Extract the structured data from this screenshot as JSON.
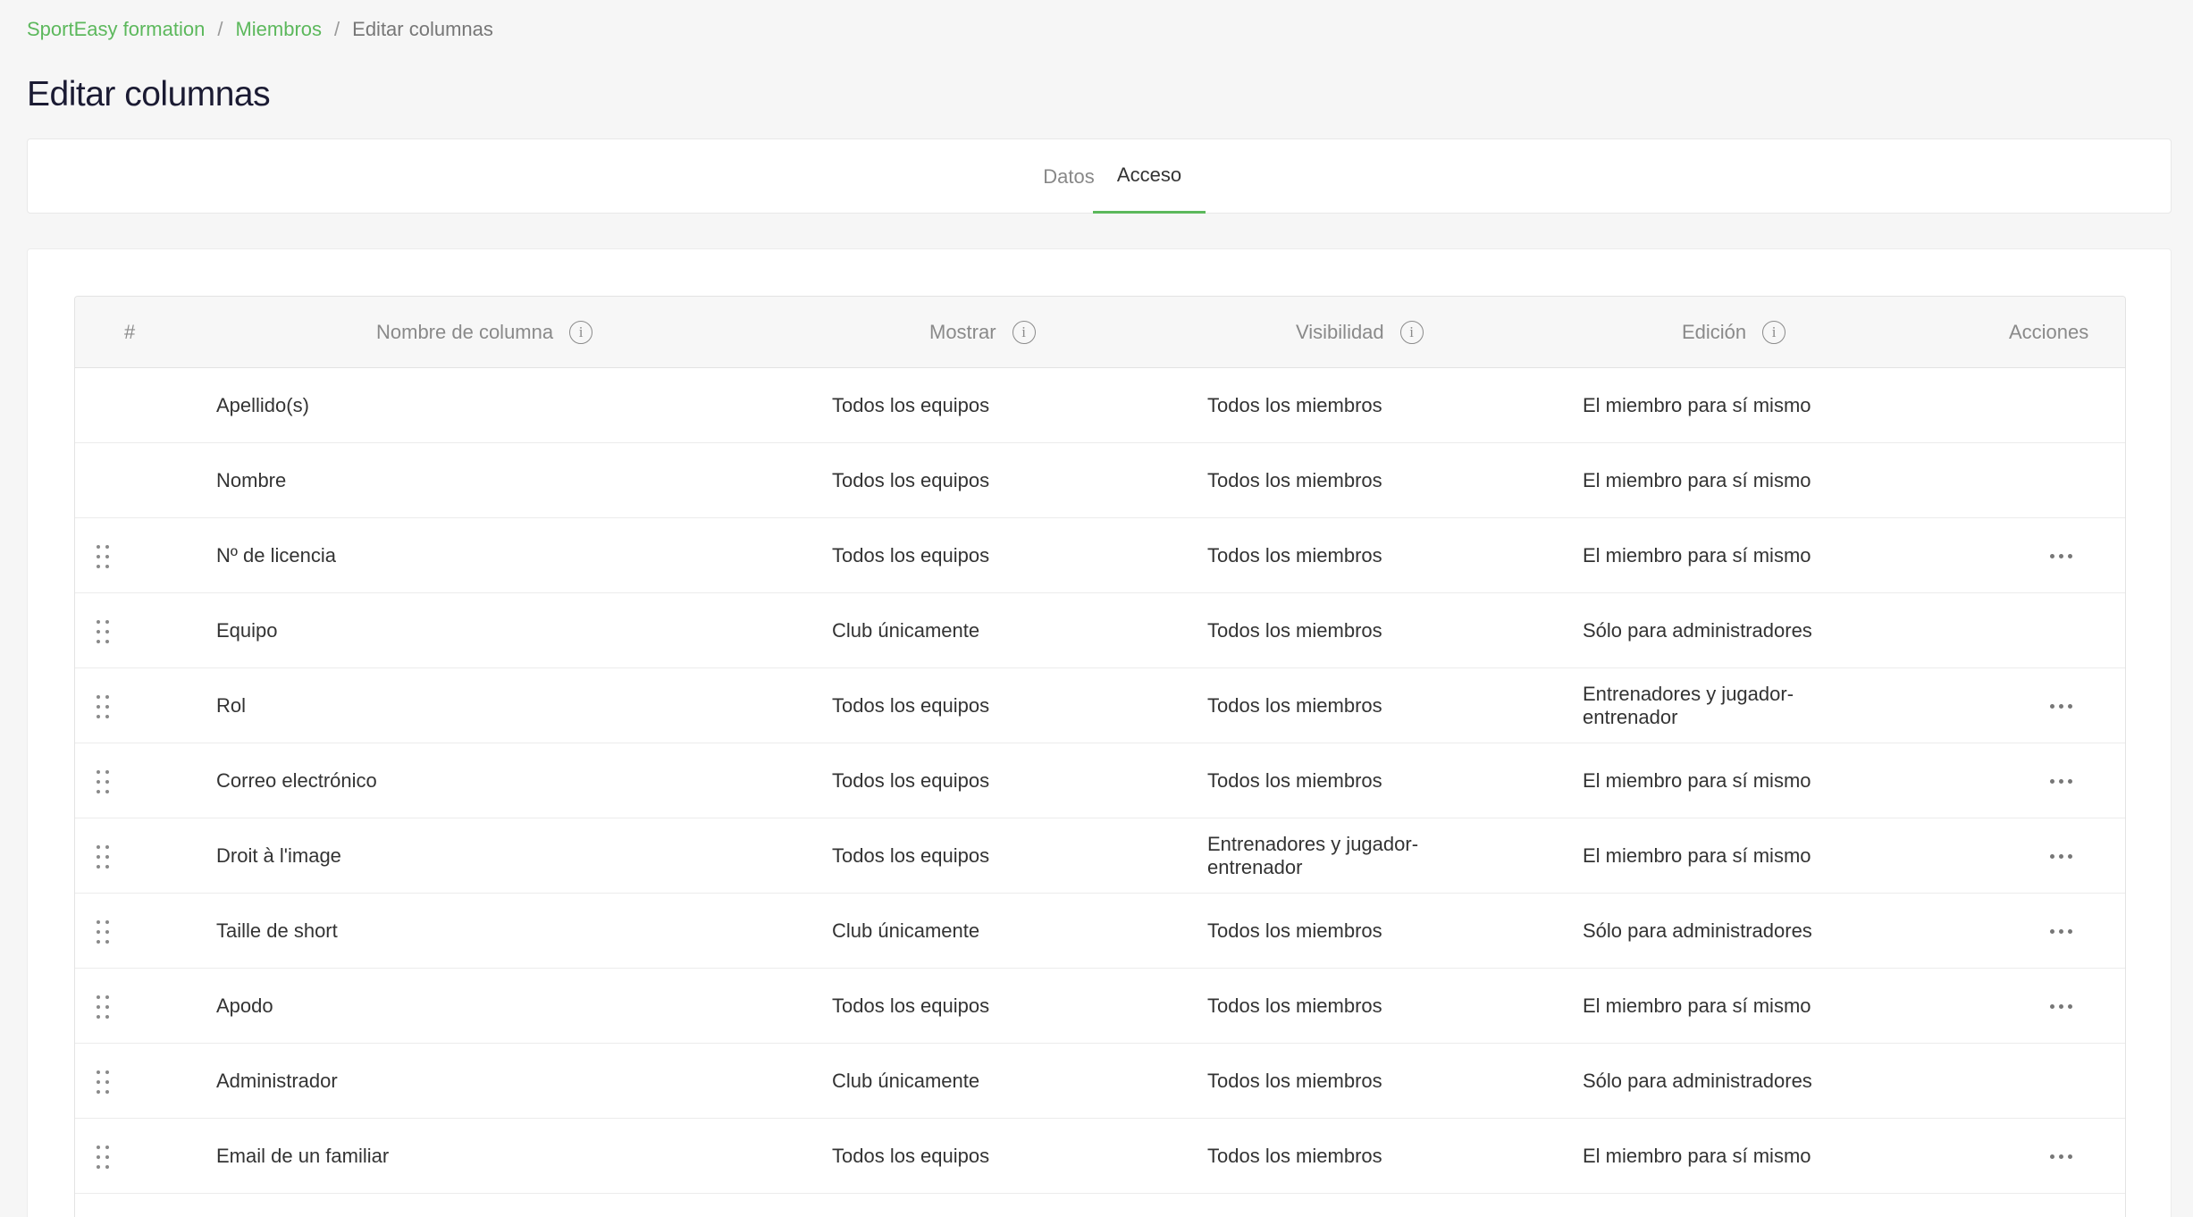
{
  "breadcrumb": {
    "items": [
      {
        "label": "SportEasy formation"
      },
      {
        "label": "Miembros"
      },
      {
        "label": "Editar columnas"
      }
    ],
    "separator": "/"
  },
  "page": {
    "title": "Editar columnas"
  },
  "tabs": [
    {
      "label": "Datos",
      "active": false
    },
    {
      "label": "Acceso",
      "active": true
    }
  ],
  "table": {
    "headers": {
      "index": "#",
      "name": "Nombre de columna",
      "show": "Mostrar",
      "visibility": "Visibilidad",
      "edit": "Edición",
      "actions": "Acciones"
    },
    "rows": [
      {
        "name": "Apellido(s)",
        "show": "Todos los equipos",
        "visibility": "Todos los miembros",
        "edit": "El miembro para sí mismo",
        "draggable": false,
        "actions": false
      },
      {
        "name": "Nombre",
        "show": "Todos los equipos",
        "visibility": "Todos los miembros",
        "edit": "El miembro para sí mismo",
        "draggable": false,
        "actions": false
      },
      {
        "name": "Nº de licencia",
        "show": "Todos los equipos",
        "visibility": "Todos los miembros",
        "edit": "El miembro para sí mismo",
        "draggable": true,
        "actions": true
      },
      {
        "name": "Equipo",
        "show": "Club únicamente",
        "visibility": "Todos los miembros",
        "edit": "Sólo para administradores",
        "draggable": true,
        "actions": false
      },
      {
        "name": "Rol",
        "show": "Todos los equipos",
        "visibility": "Todos los miembros",
        "edit": "Entrenadores y jugador-entrenador",
        "draggable": true,
        "actions": true
      },
      {
        "name": "Correo electrónico",
        "show": "Todos los equipos",
        "visibility": "Todos los miembros",
        "edit": "El miembro para sí mismo",
        "draggable": true,
        "actions": true
      },
      {
        "name": "Droit à l'image",
        "show": "Todos los equipos",
        "visibility": "Entrenadores y jugador-entrenador",
        "edit": "El miembro para sí mismo",
        "draggable": true,
        "actions": true
      },
      {
        "name": "Taille de short",
        "show": "Club únicamente",
        "visibility": "Todos los miembros",
        "edit": "Sólo para administradores",
        "draggable": true,
        "actions": true
      },
      {
        "name": "Apodo",
        "show": "Todos los equipos",
        "visibility": "Todos los miembros",
        "edit": "El miembro para sí mismo",
        "draggable": true,
        "actions": true
      },
      {
        "name": "Administrador",
        "show": "Club únicamente",
        "visibility": "Todos los miembros",
        "edit": "Sólo para administradores",
        "draggable": true,
        "actions": false
      },
      {
        "name": "Email de un familiar",
        "show": "Todos los equipos",
        "visibility": "Todos los miembros",
        "edit": "El miembro para sí mismo",
        "draggable": true,
        "actions": true
      }
    ]
  },
  "icons": {
    "info": "info-circle-icon",
    "drag": "drag-handle-icon",
    "more": "more-horizontal-icon"
  },
  "colors": {
    "accent": "#5cb85c",
    "title": "#1b1b33",
    "background": "#f6f6f6"
  }
}
